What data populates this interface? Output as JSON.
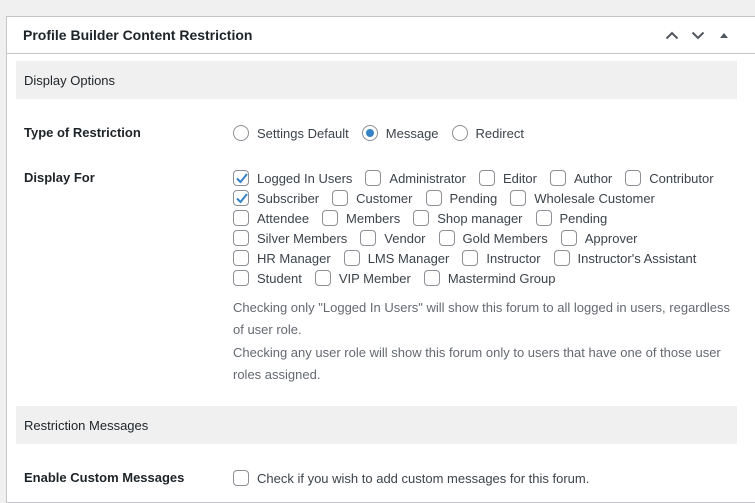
{
  "metabox": {
    "title": "Profile Builder Content Restriction",
    "controls": [
      "chevron-up-icon",
      "chevron-down-icon",
      "triangle-up-icon"
    ]
  },
  "display_options": {
    "heading": "Display Options",
    "type_of_restriction": {
      "label": "Type of Restriction",
      "options": [
        {
          "label": "Settings Default",
          "checked": false
        },
        {
          "label": "Message",
          "checked": true
        },
        {
          "label": "Redirect",
          "checked": false
        }
      ]
    },
    "display_for": {
      "label": "Display For",
      "rows": [
        [
          {
            "label": "Logged In Users",
            "checked": true
          },
          {
            "label": "Administrator",
            "checked": false
          },
          {
            "label": "Editor",
            "checked": false
          },
          {
            "label": "Author",
            "checked": false
          },
          {
            "label": "Contributor",
            "checked": false
          }
        ],
        [
          {
            "label": "Subscriber",
            "checked": true
          },
          {
            "label": "Customer",
            "checked": false
          },
          {
            "label": "Pending",
            "checked": false
          },
          {
            "label": "Wholesale Customer",
            "checked": false
          }
        ],
        [
          {
            "label": "Attendee",
            "checked": false
          },
          {
            "label": "Members",
            "checked": false
          },
          {
            "label": "Shop manager",
            "checked": false
          },
          {
            "label": "Pending",
            "checked": false
          }
        ],
        [
          {
            "label": "Silver Members",
            "checked": false
          },
          {
            "label": "Vendor",
            "checked": false
          },
          {
            "label": "Gold Members",
            "checked": false
          },
          {
            "label": "Approver",
            "checked": false
          }
        ],
        [
          {
            "label": "HR Manager",
            "checked": false
          },
          {
            "label": "LMS Manager",
            "checked": false
          },
          {
            "label": "Instructor",
            "checked": false
          },
          {
            "label": "Instructor's Assistant",
            "checked": false
          }
        ],
        [
          {
            "label": "Student",
            "checked": false
          },
          {
            "label": "VIP Member",
            "checked": false
          },
          {
            "label": "Mastermind Group",
            "checked": false
          }
        ]
      ],
      "help_1": "Checking only \"Logged In Users\" will show this forum to all logged in users, regardless of user role.",
      "help_2": "Checking any user role will show this forum only to users that have one of those user roles assigned."
    }
  },
  "restriction_messages": {
    "heading": "Restriction Messages",
    "enable_custom": {
      "label": "Enable Custom Messages",
      "checkbox_label": "Check if you wish to add custom messages for this forum.",
      "checked": false
    }
  },
  "colors": {
    "accent": "#3582c4",
    "section_bg": "#f0f0f1",
    "border": "#c3c4c7"
  }
}
